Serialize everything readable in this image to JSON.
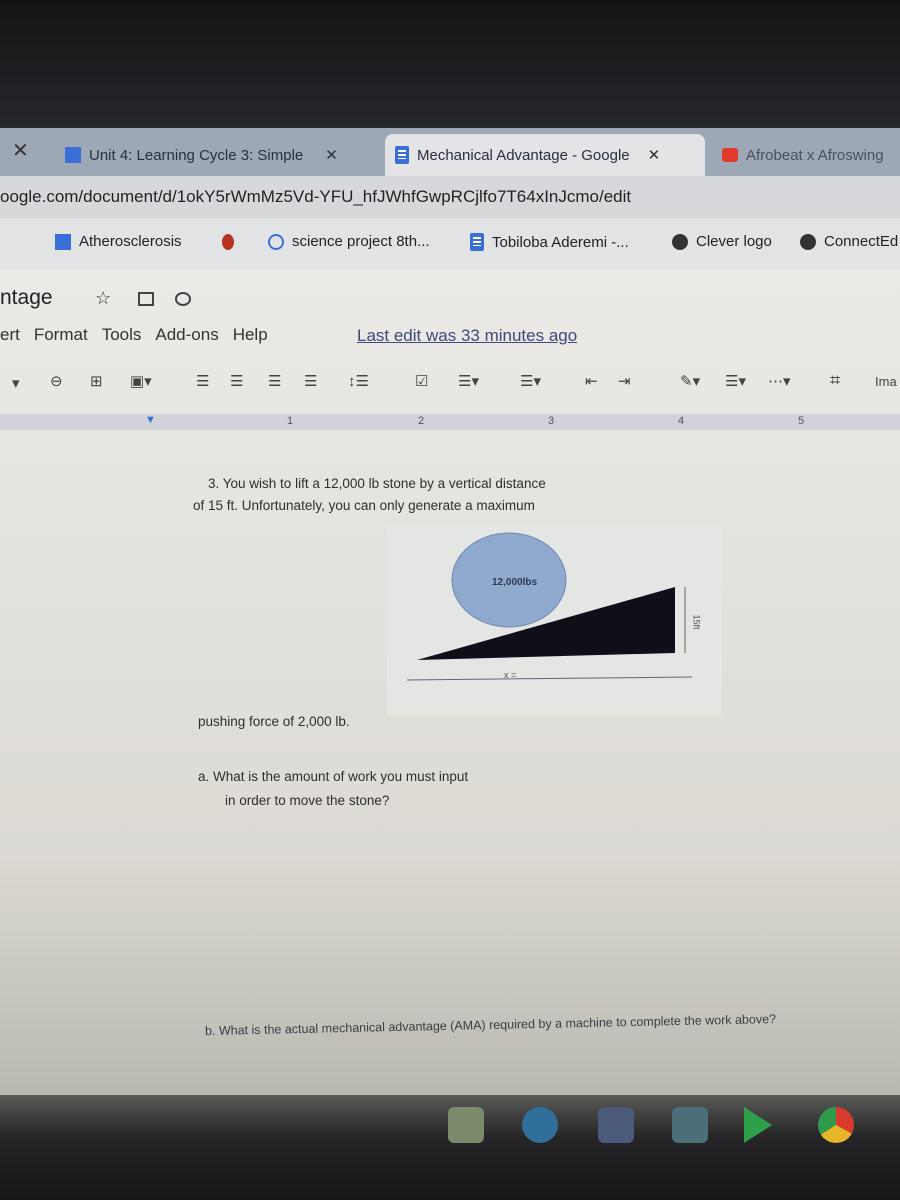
{
  "browser": {
    "tabs": [
      {
        "label": "Unit 4: Learning Cycle 3: Simple",
        "icon": "classroom-icon"
      },
      {
        "label": "Mechanical Advantage - Google",
        "icon": "docs-icon",
        "active": true
      },
      {
        "label": "Afrobeat x Afroswing",
        "icon": "youtube-icon"
      }
    ],
    "url": "oogle.com/document/d/1okY5rWmMz5Vd-YFU_hfJWhfGwpRCjlfo7T64xInJcmo/edit",
    "bookmarks": [
      "Atherosclerosis",
      "science project 8th...",
      "Tobiloba Aderemi -...",
      "Clever logo",
      "ConnectEd"
    ]
  },
  "docs": {
    "title": "ntage",
    "menu": [
      "ert",
      "Format",
      "Tools",
      "Add-ons",
      "Help"
    ],
    "last_edit": "Last edit was 33 minutes ago",
    "toolbar_image_label": "Ima",
    "ruler_marks": [
      "1",
      "2",
      "3",
      "4",
      "5"
    ]
  },
  "document": {
    "q3_line1": "3. You wish to lift a 12,000 lb stone by a vertical distance",
    "q3_line2": "of 15 ft. Unfortunately, you can only generate a maximum",
    "q3_line3": "pushing force of 2,000 lb.",
    "figure": {
      "stone_label": "12,000lbs",
      "height_label": "15ft",
      "base_label": "x ="
    },
    "qa_line1": "a. What is the amount of work you must input",
    "qa_line2": "in order to move the stone?",
    "qb": "b. What is the actual mechanical advantage (AMA) required by a machine to complete the work above?"
  },
  "taskbar": {
    "apps": [
      "calculator-icon",
      "messages-icon",
      "files-icon",
      "docs-icon",
      "play-store-icon",
      "chrome-icon"
    ]
  }
}
